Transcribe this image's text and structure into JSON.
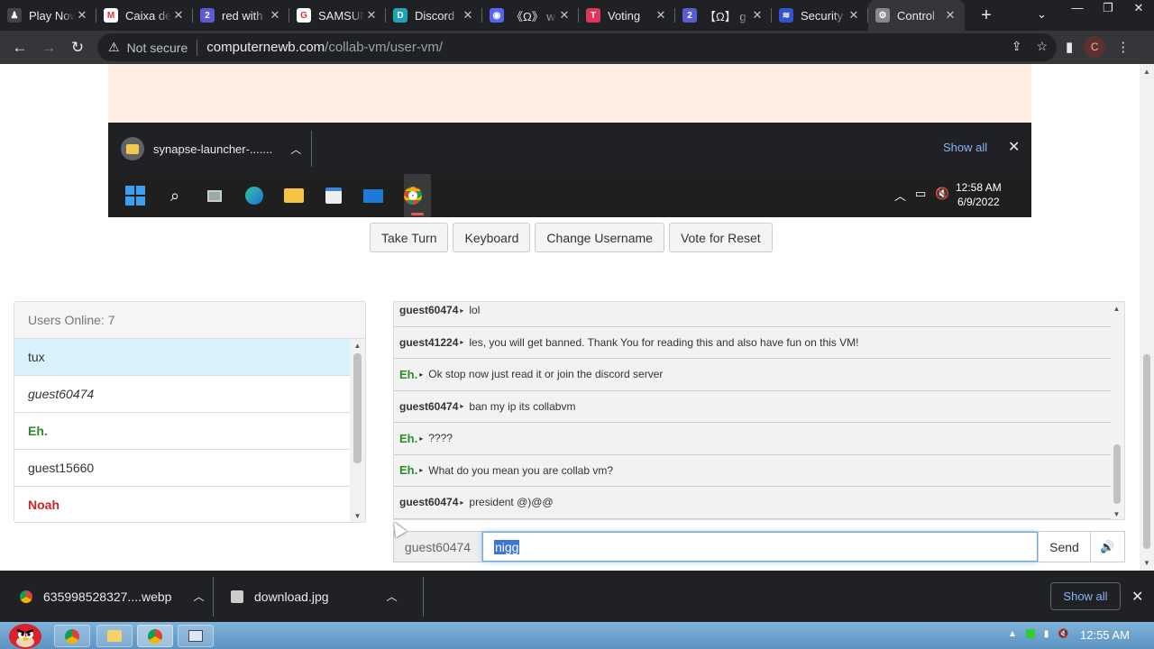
{
  "browser": {
    "tabs": [
      {
        "title": "Play Now",
        "fav_color": "#444",
        "fav_glyph": "♟"
      },
      {
        "title": "Caixa de",
        "fav_color": "#fff",
        "fav_glyph": "M"
      },
      {
        "title": "red with",
        "fav_color": "#5b5bd6",
        "fav_glyph": "2"
      },
      {
        "title": "SAMSUNG",
        "fav_color": "#fff",
        "fav_glyph": "G"
      },
      {
        "title": "Discord",
        "fav_color": "#1fa4b5",
        "fav_glyph": "D"
      },
      {
        "title": "《Ω》 w",
        "fav_color": "#5865f2",
        "fav_glyph": "◉"
      },
      {
        "title": "Voting",
        "fav_color": "#e0365a",
        "fav_glyph": "T"
      },
      {
        "title": "【Ω】 g",
        "fav_color": "#5b5bd6",
        "fav_glyph": "2"
      },
      {
        "title": "Security",
        "fav_color": "#3355cc",
        "fav_glyph": "≋"
      },
      {
        "title": "Control",
        "fav_color": "#888",
        "fav_glyph": "⚙"
      }
    ],
    "not_secure": "Not secure",
    "url_host": "computernewb.com",
    "url_path": "/collab-vm/user-vm/",
    "profile_initial": "C"
  },
  "vm": {
    "download_file": "synapse-launcher-.......",
    "show_all": "Show all",
    "clock_time": "12:58 AM",
    "clock_date": "6/9/2022"
  },
  "controls": {
    "take_turn": "Take Turn",
    "keyboard": "Keyboard",
    "change_username": "Change Username",
    "vote_reset": "Vote for Reset"
  },
  "users": {
    "header": "Users Online: 7",
    "list": [
      {
        "name": "tux",
        "style": "sel"
      },
      {
        "name": "guest60474",
        "style": "italic"
      },
      {
        "name": "Eh.",
        "style": "green"
      },
      {
        "name": "guest15660",
        "style": ""
      },
      {
        "name": "Noah",
        "style": "red"
      }
    ]
  },
  "chat": {
    "messages": [
      {
        "user": "guest60474",
        "text": "lol",
        "style": ""
      },
      {
        "user": "guest41224",
        "text": "les, you will get banned. Thank You for reading this and also have fun on this VM!",
        "style": ""
      },
      {
        "user": "Eh.",
        "text": "Ok stop now just read it or join the discord server",
        "style": "green"
      },
      {
        "user": "guest60474",
        "text": "ban my ip its collabvm",
        "style": ""
      },
      {
        "user": "Eh.",
        "text": "????",
        "style": "green"
      },
      {
        "user": "Eh.",
        "text": "What do you mean you are collab vm?",
        "style": "green"
      },
      {
        "user": "guest60474",
        "text": "president @)@@",
        "style": ""
      }
    ],
    "username": "guest60474",
    "input_value": "nigg",
    "send": "Send"
  },
  "shelf": {
    "item1": "635998528327....webp",
    "item2": "download.jpg",
    "show_all": "Show all"
  },
  "host": {
    "clock": "12:55 AM"
  }
}
